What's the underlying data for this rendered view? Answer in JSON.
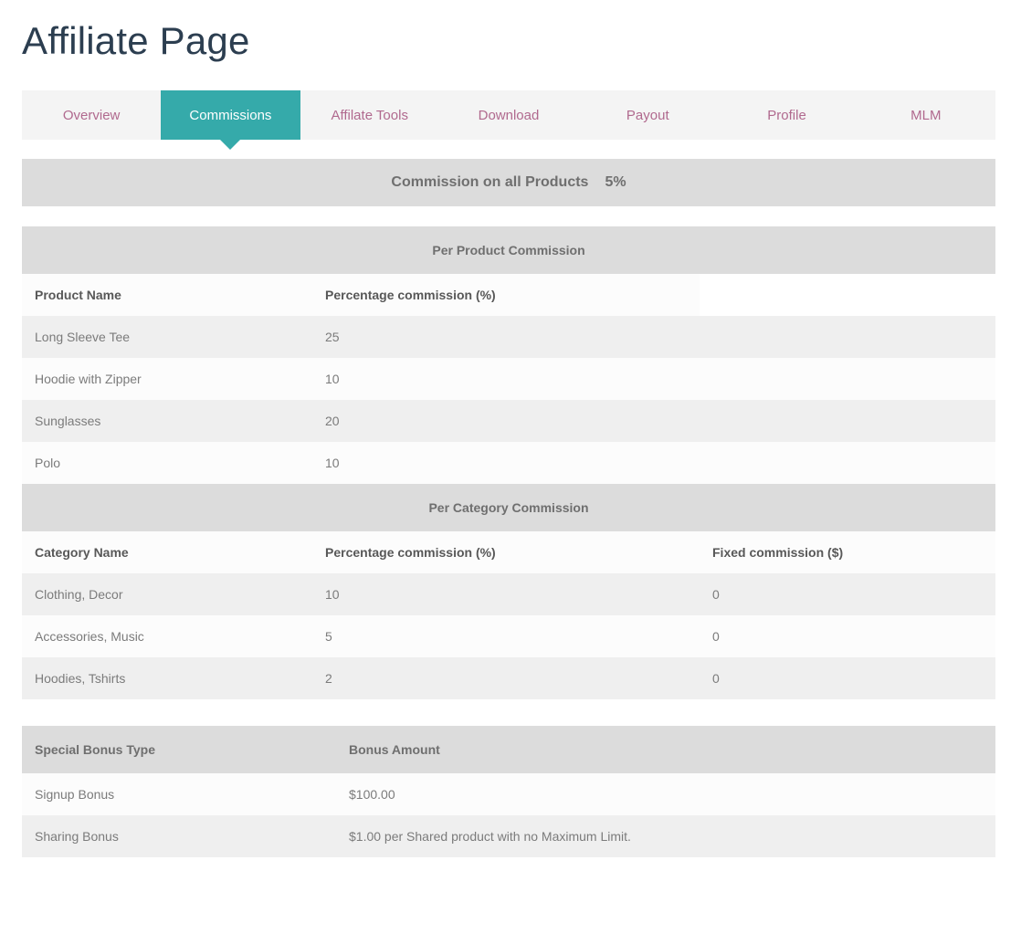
{
  "header": {
    "title": "Affiliate Page"
  },
  "tabs": [
    {
      "label": "Overview",
      "active": false
    },
    {
      "label": "Commissions",
      "active": true
    },
    {
      "label": "Affilate Tools",
      "active": false
    },
    {
      "label": "Download",
      "active": false
    },
    {
      "label": "Payout",
      "active": false
    },
    {
      "label": "Profile",
      "active": false
    },
    {
      "label": "MLM",
      "active": false
    }
  ],
  "banner": {
    "label": "Commission on all Products",
    "value": "5%"
  },
  "product_section": {
    "section_title": "Per Product Commission",
    "columns": [
      "Product Name",
      "Percentage commission (%)",
      ""
    ],
    "rows": [
      {
        "name": "Long Sleeve Tee",
        "percentage": "25"
      },
      {
        "name": "Hoodie with Zipper",
        "percentage": "10"
      },
      {
        "name": "Sunglasses",
        "percentage": "20"
      },
      {
        "name": "Polo",
        "percentage": "10"
      }
    ]
  },
  "category_section": {
    "section_title": "Per Category Commission",
    "columns": [
      "Category Name",
      "Percentage commission (%)",
      "Fixed commission ($)"
    ],
    "rows": [
      {
        "name": "Clothing, Decor",
        "percentage": "10",
        "fixed": "0"
      },
      {
        "name": "Accessories, Music",
        "percentage": "5",
        "fixed": "0"
      },
      {
        "name": "Hoodies, Tshirts",
        "percentage": "2",
        "fixed": "0"
      }
    ]
  },
  "bonus_section": {
    "columns": [
      "Special Bonus Type",
      "Bonus Amount"
    ],
    "rows": [
      {
        "type": "Signup Bonus",
        "amount": "$100.00"
      },
      {
        "type": "Sharing Bonus",
        "amount": "$1.00 per Shared product with no Maximum Limit."
      }
    ]
  },
  "colors": {
    "active_tab": "#35aaaa",
    "tab_text": "#b0698e",
    "tabbar_bg": "#f4f4f4",
    "band_bg": "#dcdcdc",
    "row_odd": "#efefef",
    "row_even": "#fcfcfc",
    "title_text": "#2c3e50"
  }
}
